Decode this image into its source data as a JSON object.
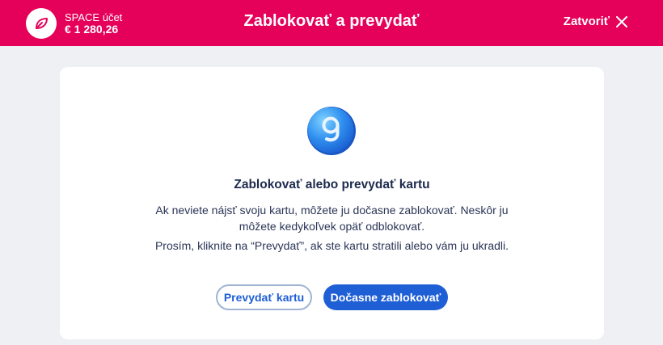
{
  "header": {
    "account_name": "SPACE účet",
    "account_balance": "€ 1 280,26",
    "title": "Zablokovať a prevydať",
    "close_label": "Zatvoriť",
    "brand_color": "#e5005a"
  },
  "card": {
    "title": "Zablokovať alebo prevydať kartu",
    "paragraph1": "Ak neviete nájsť svoju kartu, môžete ju dočasne zablokovať. Neskôr ju môžete kedykoľvek opäť odblokovať.",
    "paragraph2": "Prosím, kliknite na “Prevydať”, ak ste kartu stratili alebo vám ju ukradli.",
    "secondary_button": "Prevydať kartu",
    "primary_button": "Dočasne zablokovať",
    "accent_color": "#1f5fd6"
  },
  "icons": {
    "account": "leaf-icon",
    "close": "close-icon",
    "illustration": "george-coin-icon"
  }
}
